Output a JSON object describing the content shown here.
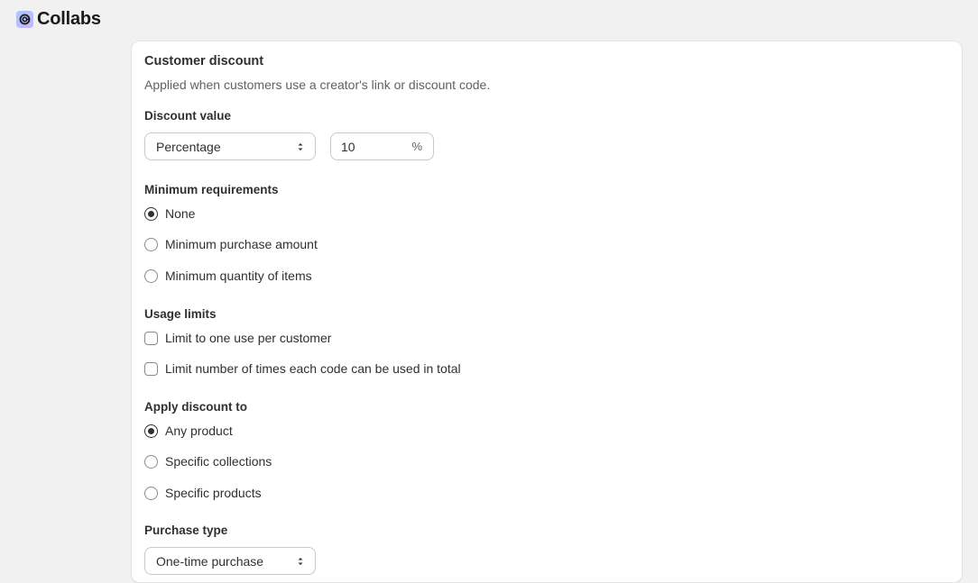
{
  "app": {
    "name": "Collabs",
    "logo_icon": "collabs-logo-icon"
  },
  "card": {
    "title": "Customer discount",
    "description": "Applied when customers use a creator's link or discount code."
  },
  "discount_value": {
    "label": "Discount value",
    "type_select": "Percentage",
    "amount": "10",
    "suffix": "%"
  },
  "minimum_requirements": {
    "label": "Minimum requirements",
    "options": [
      {
        "label": "None",
        "selected": true
      },
      {
        "label": "Minimum purchase amount",
        "selected": false
      },
      {
        "label": "Minimum quantity of items",
        "selected": false
      }
    ]
  },
  "usage_limits": {
    "label": "Usage limits",
    "options": [
      {
        "label": "Limit to one use per customer",
        "checked": false
      },
      {
        "label": "Limit number of times each code can be used in total",
        "checked": false
      }
    ]
  },
  "apply_to": {
    "label": "Apply discount to",
    "options": [
      {
        "label": "Any product",
        "selected": true
      },
      {
        "label": "Specific collections",
        "selected": false
      },
      {
        "label": "Specific products",
        "selected": false
      }
    ]
  },
  "purchase_type": {
    "label": "Purchase type",
    "select": "One-time purchase"
  }
}
